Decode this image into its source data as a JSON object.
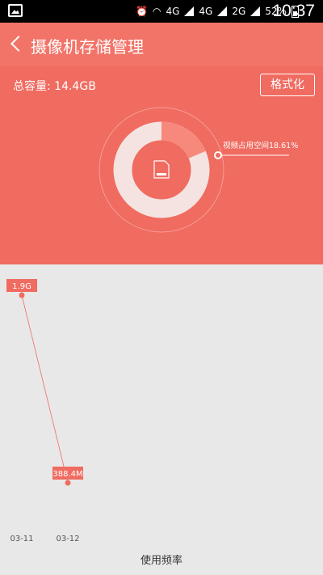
{
  "statusbar": {
    "network_a": "4G",
    "network_b": "4G",
    "network_c": "2G",
    "battery": "52%",
    "time": "10:37"
  },
  "header": {
    "title": "摄像机存储管理"
  },
  "storage": {
    "total_label": "总容量:",
    "total_value": "14.4GB",
    "format_button": "格式化",
    "usage_callout": "视频占用空间18.61%",
    "usage_percent": 18.61
  },
  "colors": {
    "accent": "#f06b60",
    "header": "#f27468",
    "background": "#e8e8e8"
  },
  "chart_data": {
    "type": "line",
    "x": [
      "03-11",
      "03-12"
    ],
    "series": [
      {
        "values": [
          "1.9G",
          "388.4M"
        ]
      }
    ],
    "data_labels": [
      "1.9G",
      "388.4M"
    ],
    "xlabel": "使用频率"
  }
}
